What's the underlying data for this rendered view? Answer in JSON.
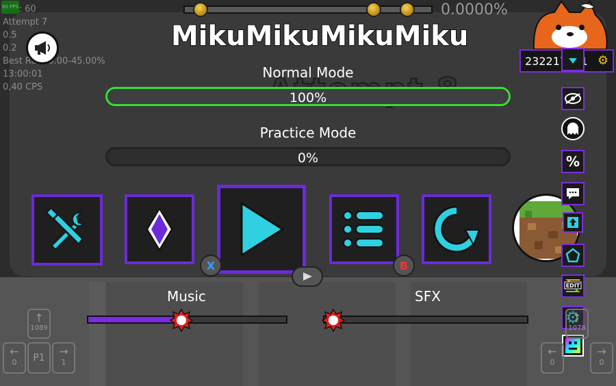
{
  "level": {
    "title": "MikuMikuMikuMiku",
    "attempt_text": "Attempt 8"
  },
  "top_progress": {
    "percent": "0.0000%",
    "progress": 0.0
  },
  "debug": {
    "fps": "FPS: 60",
    "fps_tiny": "60 FPS",
    "lines": [
      "Attempt 7",
      "0.5",
      "0.2",
      "Best Run: 0.00-45.00%",
      "13:00:01",
      "0,40 CPS"
    ]
  },
  "normal_mode": {
    "label": "Normal Mode",
    "percent_text": "100%",
    "progress": 1.0
  },
  "practice_mode": {
    "label": "Practice Mode",
    "percent_text": "0%",
    "progress": 0.0
  },
  "buttons": {
    "x_key": "X",
    "b_key": "B"
  },
  "sliders": {
    "music": {
      "label": "Music",
      "value": 0.47
    },
    "sfx": {
      "label": "SFX",
      "value": 0.05
    }
  },
  "counter": {
    "value": "232217211"
  },
  "controls": {
    "left_up_count": "1089",
    "left_p1": "P1",
    "left_left_count": "0",
    "left_right_count": "1",
    "right_up_count": "1078",
    "right_left_count": "0",
    "right_right_count": "0"
  },
  "colors": {
    "accent_purple": "#7b2be0",
    "normal_border": "#35e035",
    "icon_cyan": "#2fd0e0"
  }
}
